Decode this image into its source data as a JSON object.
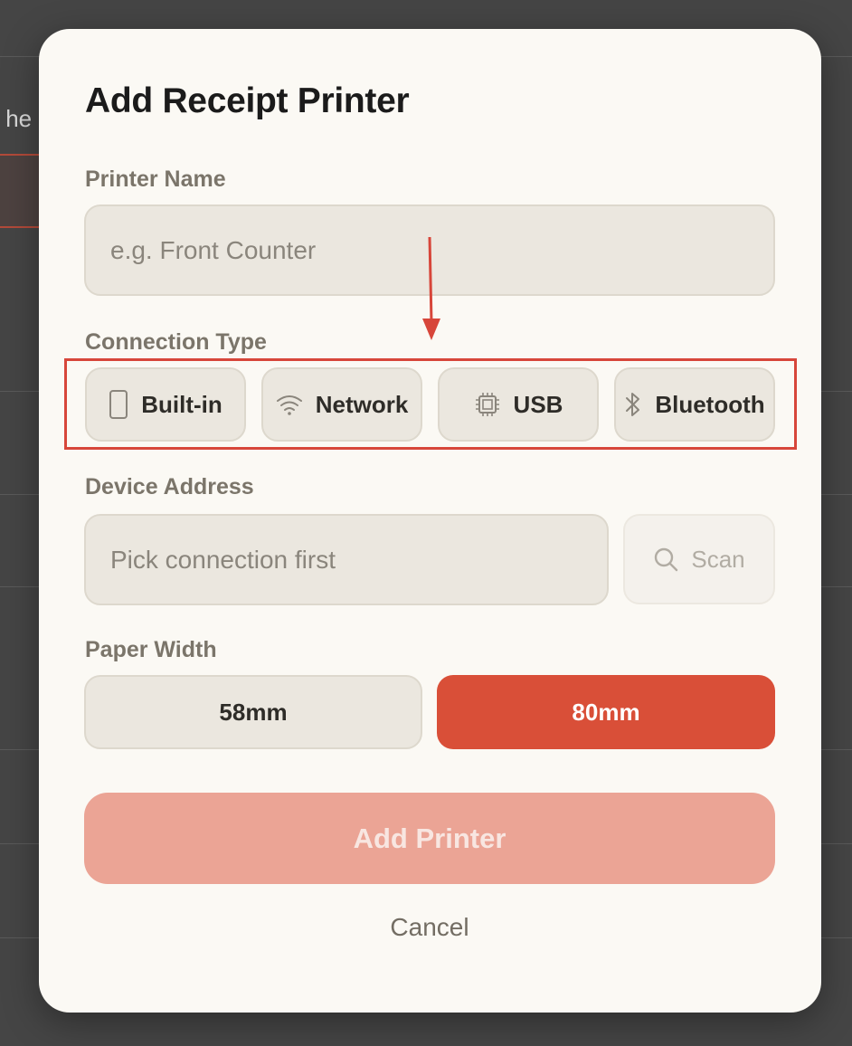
{
  "background": {
    "partial_text": "k he"
  },
  "dialog": {
    "title": "Add Receipt Printer",
    "printer_name": {
      "label": "Printer Name",
      "value": "",
      "placeholder": "e.g. Front Counter"
    },
    "connection_type": {
      "label": "Connection Type",
      "options": [
        {
          "label": "Built-in",
          "icon": "phone-icon"
        },
        {
          "label": "Network",
          "icon": "wifi-icon"
        },
        {
          "label": "USB",
          "icon": "chip-icon"
        },
        {
          "label": "Bluetooth",
          "icon": "bluetooth-icon"
        }
      ]
    },
    "device_address": {
      "label": "Device Address",
      "value": "",
      "placeholder": "Pick connection first",
      "scan_label": "Scan",
      "scan_icon": "search-icon"
    },
    "paper_width": {
      "label": "Paper Width",
      "options": [
        "58mm",
        "80mm"
      ],
      "selected": "80mm"
    },
    "add_button_label": "Add Printer",
    "cancel_label": "Cancel"
  },
  "colors": {
    "accent": "#d94f38",
    "accent_disabled": "#eba495",
    "annotation": "#d7463a",
    "surface": "#fbf9f4",
    "field": "#ebe7df"
  }
}
